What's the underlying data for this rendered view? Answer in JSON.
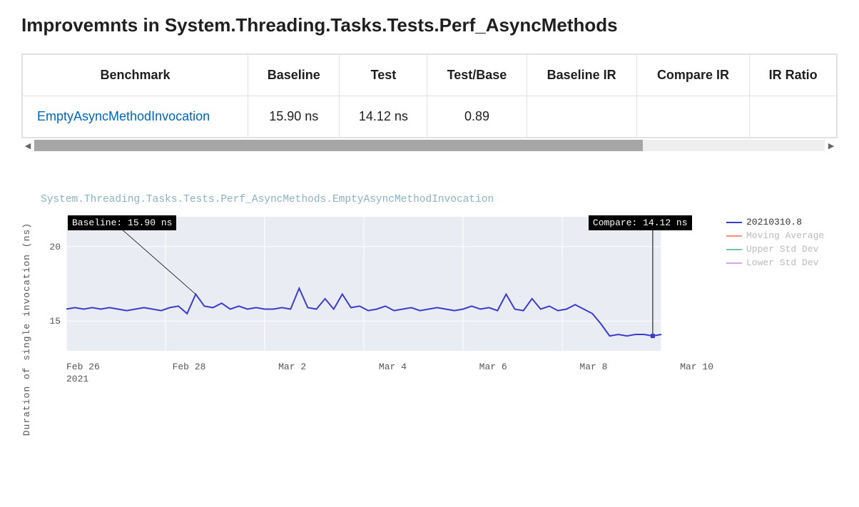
{
  "heading": "Improvemnts in System.Threading.Tasks.Tests.Perf_AsyncMethods",
  "table": {
    "headers": [
      "Benchmark",
      "Baseline",
      "Test",
      "Test/Base",
      "Baseline IR",
      "Compare IR",
      "IR Ratio"
    ],
    "rows": [
      {
        "benchmark": "EmptyAsyncMethodInvocation",
        "benchmark_href": "#",
        "baseline": "15.90 ns",
        "test": "14.12 ns",
        "test_base": "0.89",
        "baseline_ir": "",
        "compare_ir": "",
        "ir_ratio": ""
      }
    ]
  },
  "chart_data": {
    "type": "line",
    "title": "System.Threading.Tasks.Tests.Perf_AsyncMethods.EmptyAsyncMethodInvocation",
    "ylabel": "Duration of single invocation (ns)",
    "ylim": [
      13,
      22
    ],
    "yticks": [
      15,
      20
    ],
    "xticks": [
      "Feb 26",
      "Feb 28",
      "Mar 2",
      "Mar 4",
      "Mar 6",
      "Mar 8",
      "Mar 10"
    ],
    "xyear": "2021",
    "legend": [
      {
        "name": "20210310.8",
        "color": "#3c3cc8",
        "active": true
      },
      {
        "name": "Moving Average",
        "color": "#f28e7b",
        "active": false
      },
      {
        "name": "Upper Std Dev",
        "color": "#6fc9a5",
        "active": false
      },
      {
        "name": "Lower Std Dev",
        "color": "#cfa8e8",
        "active": false
      }
    ],
    "annotations": {
      "baseline": "Baseline: 15.90 ns",
      "compare": "Compare: 14.12 ns"
    },
    "series": [
      {
        "name": "20210310.8",
        "color": "#3c3cc8",
        "x": [
          0,
          1,
          2,
          3,
          4,
          5,
          6,
          7,
          8,
          9,
          10,
          11,
          12,
          13,
          14,
          15,
          16,
          17,
          18,
          19,
          20,
          21,
          22,
          23,
          24,
          25,
          26,
          27,
          28,
          29,
          30,
          31,
          32,
          33,
          34,
          35,
          36,
          37,
          38,
          39,
          40,
          41,
          42,
          43,
          44,
          45,
          46,
          47,
          48,
          49,
          50,
          51,
          52,
          53,
          54,
          55,
          56,
          57,
          58,
          59,
          60,
          61,
          62,
          63,
          64,
          65,
          66,
          67,
          68,
          69
        ],
        "y": [
          15.8,
          15.9,
          15.8,
          15.9,
          15.8,
          15.9,
          15.8,
          15.7,
          15.8,
          15.9,
          15.8,
          15.7,
          15.9,
          16.0,
          15.5,
          16.8,
          16.0,
          15.9,
          16.2,
          15.8,
          16.0,
          15.8,
          15.9,
          15.8,
          15.8,
          15.9,
          15.8,
          17.2,
          15.9,
          15.8,
          16.5,
          15.8,
          16.8,
          15.9,
          16.0,
          15.7,
          15.8,
          16.0,
          15.7,
          15.8,
          15.9,
          15.7,
          15.8,
          15.9,
          15.8,
          15.7,
          15.8,
          16.0,
          15.8,
          15.9,
          15.7,
          16.8,
          15.8,
          15.7,
          16.5,
          15.8,
          16.0,
          15.7,
          15.8,
          16.1,
          15.8,
          15.5,
          14.8,
          14.0,
          14.1,
          14.0,
          14.1,
          14.1,
          14.0,
          14.1
        ]
      }
    ],
    "baseline_point_idx": 15,
    "compare_point_idx": 68
  }
}
